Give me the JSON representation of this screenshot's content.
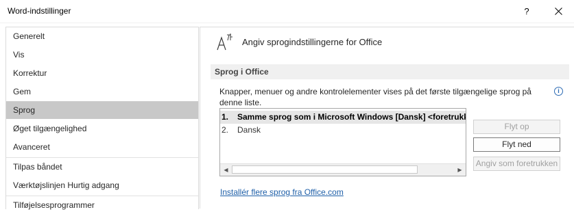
{
  "window": {
    "title": "Word-indstillinger",
    "help_label": "?",
    "close_label": "✕"
  },
  "sidebar": {
    "items": [
      {
        "label": "Generelt"
      },
      {
        "label": "Vis"
      },
      {
        "label": "Korrektur"
      },
      {
        "label": "Gem"
      },
      {
        "label": "Sprog",
        "selected": true
      },
      {
        "label": "Øget tilgængelighed"
      },
      {
        "label": "Avanceret"
      },
      {
        "label": "Tilpas båndet"
      },
      {
        "label": "Værktøjslinjen Hurtig adgang"
      },
      {
        "label": "Tilføjelsesprogrammer"
      }
    ]
  },
  "main": {
    "header": "Angiv sprogindstillingerne for Office",
    "header_icon": "language-icon",
    "section_title": "Sprog i Office",
    "description": "Knapper, menuer og andre kontrolelementer vises på det første tilgængelige sprog på denne liste.",
    "info_icon": "info-icon",
    "languages": [
      {
        "num": "1.",
        "text": "Samme sprog som i Microsoft Windows [Dansk] <foretrukken>",
        "bold": true
      },
      {
        "num": "2.",
        "text": "Dansk",
        "bold": false
      }
    ],
    "buttons": {
      "move_up": "Flyt op",
      "move_down": "Flyt ned",
      "set_preferred": "Angiv som foretrukken"
    },
    "install_link": "Installér flere sprog fra Office.com"
  },
  "colors": {
    "selected_nav": "#c8c8c8",
    "section_band": "#f0f0f0",
    "link": "#1e5fa8"
  }
}
